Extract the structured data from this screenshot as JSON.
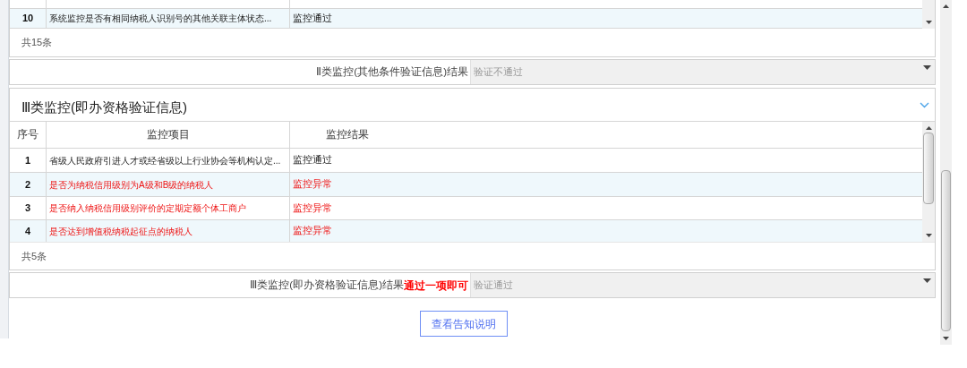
{
  "table_1": {
    "rows": [
      {
        "index": "10",
        "item": "系统监控是否有相同纳税人识别号的其他关联主体状态...",
        "result": "监控通过",
        "alert": false
      }
    ],
    "total": "共15条"
  },
  "result_1": {
    "label": "Ⅱ类监控(其他条件验证信息)结果",
    "value": "验证不通过"
  },
  "section": {
    "title": "Ⅲ类监控(即办资格验证信息)",
    "expanded": true,
    "columns": [
      "序号",
      "监控项目",
      "监控结果"
    ],
    "rows": [
      {
        "index": "1",
        "item": "省级人民政府引进人才或经省级以上行业协会等机构认定...",
        "result": "监控通过",
        "alert": false
      },
      {
        "index": "2",
        "item": "是否为纳税信用级别为A级和B级的纳税人",
        "result": "监控异常",
        "alert": true
      },
      {
        "index": "3",
        "item": "是否纳入纳税信用级别评价的定期定额个体工商户",
        "result": "监控异常",
        "alert": true
      },
      {
        "index": "4",
        "item": "是否达到增值税纳税起征点的纳税人",
        "result": "监控异常",
        "alert": true
      }
    ],
    "total": "共5条"
  },
  "result_2": {
    "label": "Ⅲ类监控(即办资格验证信息)结果",
    "note": "通过一项即可",
    "value": "验证通过"
  },
  "button": "查看告知说明"
}
